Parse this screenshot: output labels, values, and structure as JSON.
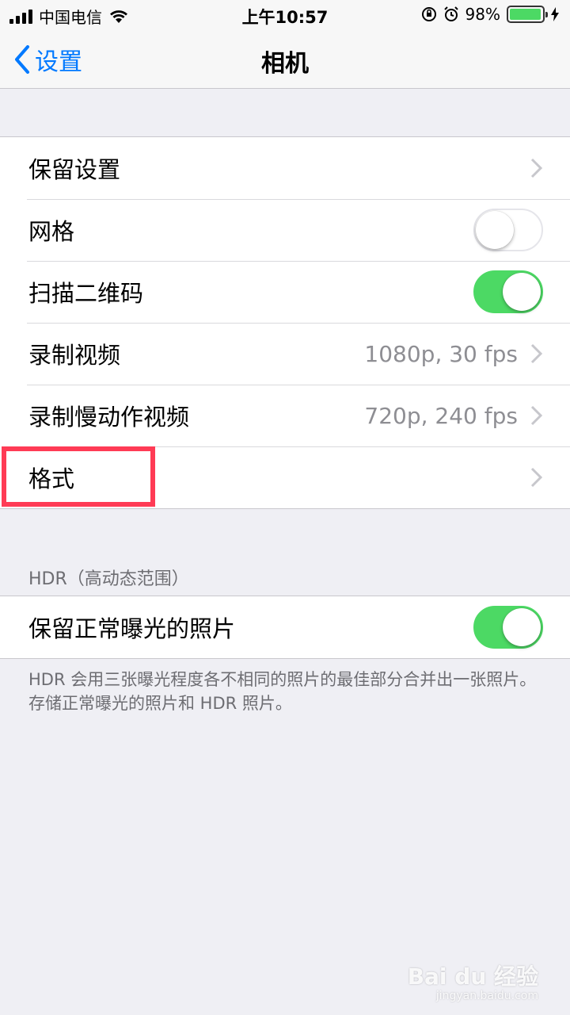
{
  "status_bar": {
    "carrier": "中国电信",
    "time": "上午10:57",
    "battery_percent": "98%",
    "battery_level": 0.98
  },
  "nav": {
    "back_label": "设置",
    "title": "相机"
  },
  "group1": {
    "rows": [
      {
        "label": "保留设置",
        "type": "chevron"
      },
      {
        "label": "网格",
        "type": "toggle",
        "on": false
      },
      {
        "label": "扫描二维码",
        "type": "toggle",
        "on": true
      },
      {
        "label": "录制视频",
        "value": "1080p, 30 fps",
        "type": "chevron"
      },
      {
        "label": "录制慢动作视频",
        "value": "720p, 240 fps",
        "type": "chevron"
      },
      {
        "label": "格式",
        "type": "chevron"
      }
    ]
  },
  "hdr": {
    "header": "HDR（高动态范围）",
    "row_label": "保留正常曝光的照片",
    "row_on": true,
    "footer": "HDR 会用三张曝光程度各不相同的照片的最佳部分合并出一张照片。存储正常曝光的照片和 HDR 照片。"
  },
  "watermark": {
    "text": "Bai du 经验",
    "sub": "jingyan.baidu.com"
  },
  "colors": {
    "accent": "#0079ff",
    "toggle_on": "#4cd964",
    "highlight": "#ff3b55"
  }
}
